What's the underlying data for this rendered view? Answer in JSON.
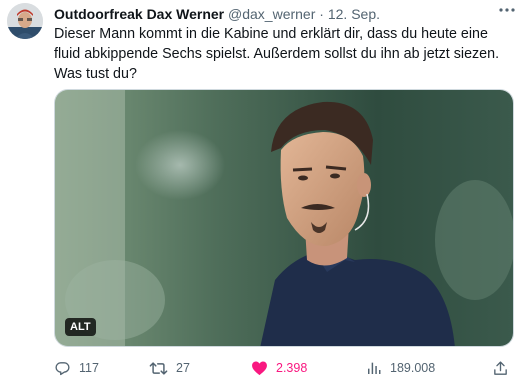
{
  "tweet": {
    "author": {
      "name": "Outdoorfreak Dax Werner",
      "handle": "@dax_werner",
      "separator": "·",
      "date": "12. Sep."
    },
    "text": "Dieser Mann kommt in die Kabine und erklärt dir, dass du heute eine fluid abkippende Sechs spielst. Außerdem sollst du ihn ab jetzt siezen. Was tust du?",
    "media": {
      "alt_label": "ALT"
    },
    "actions": {
      "replies": "117",
      "retweets": "27",
      "likes": "2.398",
      "views": "189.008"
    }
  },
  "icons": {
    "more": "more-horizontal-icon",
    "reply": "reply-bubble-icon",
    "retweet": "retweet-arrows-icon",
    "like": "heart-filled-icon",
    "views": "bar-chart-icon",
    "share": "share-upload-icon"
  },
  "colors": {
    "text_primary": "#0f1419",
    "text_secondary": "#536471",
    "like_pink": "#f91880",
    "border": "#cfd9de"
  }
}
